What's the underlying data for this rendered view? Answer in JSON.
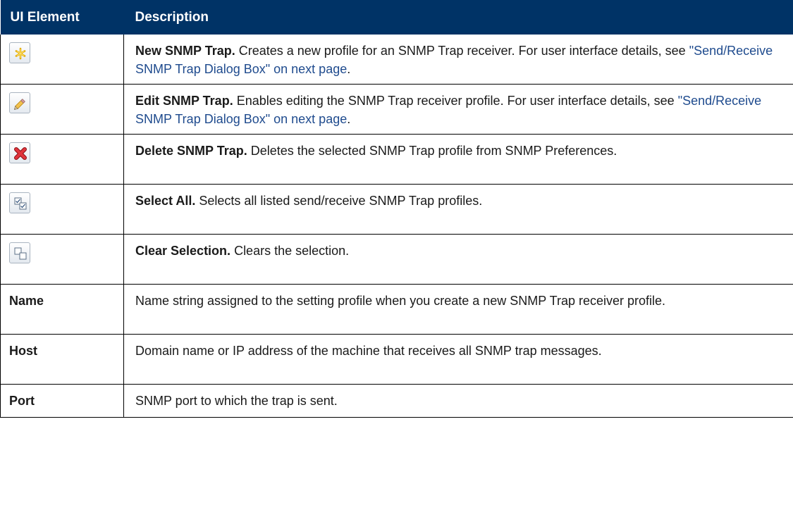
{
  "header": {
    "col1": "UI Element",
    "col2": "Description"
  },
  "rows": [
    {
      "icon": "new-star-icon",
      "title": "New SNMP Trap.",
      "text": " Creates a new profile for an SNMP Trap receiver. For user interface details, see ",
      "link": "\"Send/Receive SNMP Trap Dialog Box\" on next page",
      "after": "."
    },
    {
      "icon": "edit-pencil-icon",
      "title": "Edit SNMP Trap.",
      "text": " Enables editing the SNMP Trap receiver profile. For user interface details, see ",
      "link": "\"Send/Receive SNMP Trap Dialog Box\" on next page",
      "after": "."
    },
    {
      "icon": "delete-x-icon",
      "title": "Delete SNMP Trap.",
      "text": " Deletes the selected SNMP Trap profile from SNMP Preferences.",
      "link": "",
      "after": ""
    },
    {
      "icon": "select-all-icon",
      "title": "Select All.",
      "text": " Selects all listed send/receive SNMP Trap profiles.",
      "link": "",
      "after": ""
    },
    {
      "icon": "clear-selection-icon",
      "title": "Clear Selection.",
      "text": "  Clears the selection.",
      "link": "",
      "after": ""
    },
    {
      "name": "Name",
      "text": "Name string assigned to the setting profile when you create a new SNMP Trap receiver profile."
    },
    {
      "name": "Host",
      "text": "Domain name or IP address of the machine that receives all SNMP trap messages."
    },
    {
      "name": "Port",
      "text": "SNMP port to which the trap is sent."
    }
  ],
  "colors": {
    "header_bg": "#003366",
    "header_text": "#ffffff",
    "link": "#1f4b8e",
    "star": "#f3c21b",
    "delete": "#d8202a"
  }
}
